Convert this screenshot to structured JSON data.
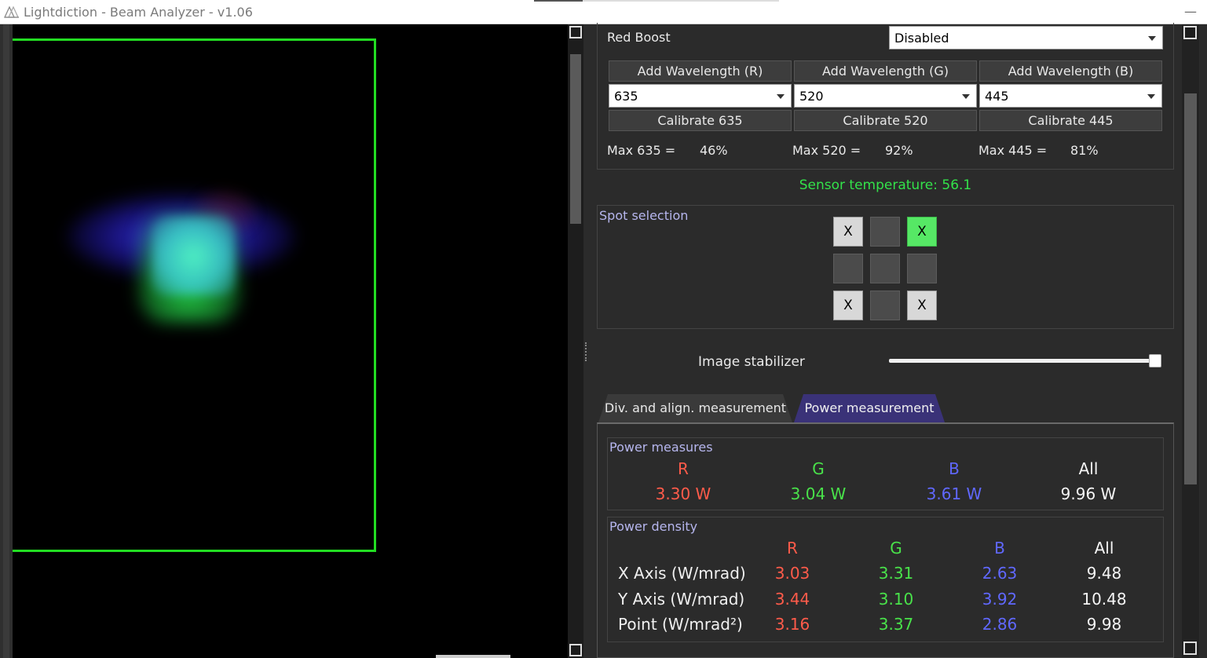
{
  "window": {
    "title": "Lightdiction - Beam Analyzer - v1.06",
    "minimize_glyph": "—"
  },
  "colors": {
    "accent_green": "#33e24a",
    "frame_green": "#22dd22",
    "red": "#ff5b4a",
    "green": "#49e24a",
    "blue": "#6068ff",
    "tab_active": "#3a3278"
  },
  "settings": {
    "red_boost_label": "Red Boost",
    "red_boost_value": "Disabled",
    "channels": [
      {
        "add_label": "Add Wavelength (R)",
        "wavelength": "635",
        "calibrate_label": "Calibrate 635",
        "max_label": "Max 635 =",
        "max_value": "46%"
      },
      {
        "add_label": "Add Wavelength (G)",
        "wavelength": "520",
        "calibrate_label": "Calibrate 520",
        "max_label": "Max 520 =",
        "max_value": "92%"
      },
      {
        "add_label": "Add Wavelength (B)",
        "wavelength": "445",
        "calibrate_label": "Calibrate 445",
        "max_label": "Max 445 =",
        "max_value": "81%"
      }
    ],
    "sensor_temperature": "Sensor temperature: 56.1"
  },
  "spot_selection": {
    "title": "Spot selection",
    "cells": [
      {
        "mark": "X",
        "state": "x"
      },
      {
        "mark": "",
        "state": "empty"
      },
      {
        "mark": "X",
        "state": "on"
      },
      {
        "mark": "",
        "state": "empty"
      },
      {
        "mark": "",
        "state": "empty"
      },
      {
        "mark": "",
        "state": "empty"
      },
      {
        "mark": "X",
        "state": "x"
      },
      {
        "mark": "",
        "state": "empty"
      },
      {
        "mark": "X",
        "state": "x"
      }
    ]
  },
  "image_stabilizer": {
    "label": "Image stabilizer",
    "level": 1.0
  },
  "tabs": [
    {
      "label": "Div. and align. measurement",
      "active": false
    },
    {
      "label": "Power measurement",
      "active": true
    }
  ],
  "power_measures": {
    "title": "Power measures",
    "headers": [
      "R",
      "G",
      "B",
      "All"
    ],
    "values": [
      "3.30 W",
      "3.04 W",
      "3.61 W",
      "9.96 W"
    ]
  },
  "power_density": {
    "title": "Power density",
    "headers": [
      "R",
      "G",
      "B",
      "All"
    ],
    "rows": [
      {
        "label": "X Axis (W/mrad)",
        "values": [
          "3.03",
          "3.31",
          "2.63",
          "9.48"
        ]
      },
      {
        "label": "Y Axis (W/mrad)",
        "values": [
          "3.44",
          "3.10",
          "3.92",
          "10.48"
        ]
      },
      {
        "label": "Point (W/mrad²)",
        "values": [
          "3.16",
          "3.37",
          "2.86",
          "9.98"
        ]
      }
    ]
  }
}
